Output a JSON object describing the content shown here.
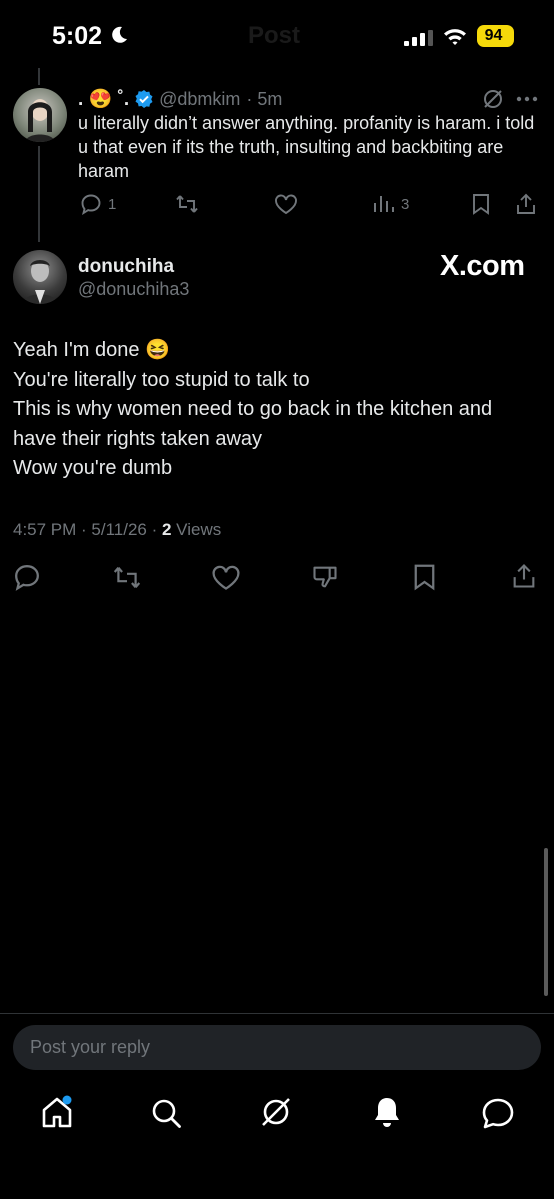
{
  "status_bar": {
    "time": "5:02",
    "battery": "94"
  },
  "header": {
    "title": "Post"
  },
  "parent_post": {
    "name": ". 😍 ˚.",
    "handle": "@dbmkim",
    "time": "· 5m",
    "text": "u literally didn’t answer anything. profanity is haram. i told u that even if its the truth, insulting and backbiting are haram",
    "reply_count": "1",
    "view_count": "3"
  },
  "main_post": {
    "name": "donuchiha",
    "handle": "@donuchiha3",
    "watermark": "X.com",
    "lines": [
      "Yeah I'm done 😆",
      "You're literally too stupid to talk to",
      "This is why women need to go back in the kitchen and",
      "have their rights taken away",
      "Wow you're dumb"
    ],
    "timestamp": "4:57 PM · 5/11/26 · ",
    "views_count": "2",
    "views_label": " Views"
  },
  "reply_input": {
    "placeholder": "Post your reply"
  },
  "colors": {
    "background": "#000000",
    "text": "#e7e9ea",
    "muted": "#71767b",
    "verified": "#1d9bf0",
    "battery": "#f5d90a"
  }
}
